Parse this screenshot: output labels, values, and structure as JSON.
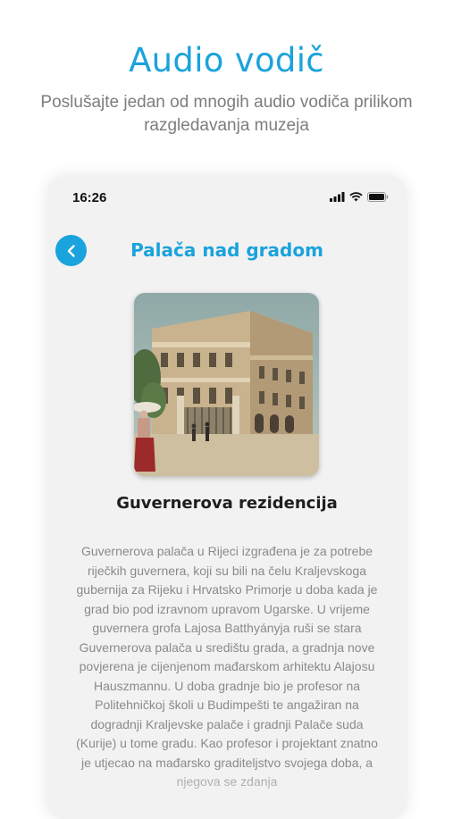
{
  "promo": {
    "title": "Audio vodič",
    "subtitle": "Poslušajte jedan od mnogih audio vodiča prilikom razgledavanja muzeja"
  },
  "status_bar": {
    "time": "16:26",
    "icons": [
      "signal-icon",
      "wifi-icon",
      "battery-icon"
    ]
  },
  "screen": {
    "title": "Palača nad gradom",
    "item_title": "Guvernerova rezidencija",
    "description": "Guvernerova palača u Rijeci izgrađena je za potrebe riječkih guvernera, koji su bili na čelu Kraljevskoga gubernija za Rijeku i Hrvatsko Primorje u doba kada je grad bio pod izravnom upravom Ugarske. U vrijeme guvernera grofa Lajosa Batthyányja ruši se stara Guvernerova palača u središtu grada, a gradnja nove povjerena je cijenjenom mađarskom arhitektu Alajosu Hauszmannu. U doba gradnje bio je profesor na Politehničkoj školi u Budimpešti te angažiran na dogradnji Kraljevske palače i gradnji Palače suda (Kurije) u tome gradu. Kao profesor i projektant znatno je utjecao na mađarsko graditeljstvo svojega doba, a njegova se zdanja"
  },
  "colors": {
    "accent": "#1aa3dc",
    "phone_bg": "#f2f2f2",
    "subtitle_text": "#7d7d7d",
    "body_text": "#8a8a8a"
  }
}
